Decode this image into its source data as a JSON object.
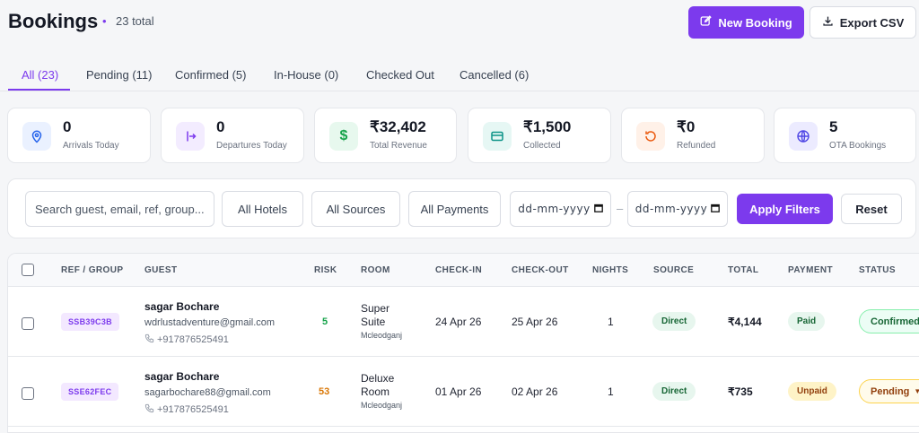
{
  "header": {
    "title": "Bookings",
    "dot": "•",
    "total": "23 total",
    "new_booking": "New Booking",
    "export_csv": "Export CSV"
  },
  "tabs": [
    {
      "label": "All (23)",
      "active": true
    },
    {
      "label": "Pending (11)"
    },
    {
      "label": "Confirmed (5)"
    },
    {
      "label": "In-House (0)"
    },
    {
      "label": "Checked Out"
    },
    {
      "label": "Cancelled (6)"
    }
  ],
  "stats": [
    {
      "value": "0",
      "label": "Arrivals Today",
      "icon": "location-pin-icon",
      "color": "#2563eb"
    },
    {
      "value": "0",
      "label": "Departures Today",
      "icon": "logout-icon",
      "color": "#7c3aed"
    },
    {
      "value": "₹32,402",
      "label": "Total Revenue",
      "icon": "dollar-icon",
      "color": "#16a34a"
    },
    {
      "value": "₹1,500",
      "label": "Collected",
      "icon": "credit-card-icon",
      "color": "#0d9488"
    },
    {
      "value": "₹0",
      "label": "Refunded",
      "icon": "refund-icon",
      "color": "#ea580c"
    },
    {
      "value": "5",
      "label": "OTA Bookings",
      "icon": "globe-icon",
      "color": "#4f46e5"
    }
  ],
  "filters": {
    "search_placeholder": "Search guest, email, ref, group...",
    "hotels": "All Hotels",
    "sources": "All Sources",
    "payments": "All Payments",
    "date_from": "dd-mm-yyyy",
    "date_sep": "–",
    "date_to": "dd-mm-yyyy",
    "apply": "Apply Filters",
    "reset": "Reset"
  },
  "table": {
    "columns": [
      "REF / GROUP",
      "GUEST",
      "RISK",
      "ROOM",
      "CHECK-IN",
      "CHECK-OUT",
      "NIGHTS",
      "SOURCE",
      "TOTAL",
      "PAYMENT",
      "STATUS"
    ],
    "rows": [
      {
        "ref": "SSB39C3B",
        "guest_name": "sagar Bochare",
        "email": "wdrlustadventure@gmail.com",
        "phone": "+917876525491",
        "risk": "5",
        "risk_color": "#16a34a",
        "room": "Super Suite",
        "location": "Mcleodganj",
        "check_in": "24 Apr 26",
        "check_out": "25 Apr 26",
        "nights": "1",
        "source": "Direct",
        "total": "₹4,144",
        "payment": "Paid",
        "status": "Confirmed"
      },
      {
        "ref": "SSE62FEC",
        "guest_name": "sagar Bochare",
        "email": "sagarbochare88@gmail.com",
        "phone": "+917876525491",
        "risk": "53",
        "risk_color": "#d97706",
        "room": "Deluxe Room",
        "location": "Mcleodganj",
        "check_in": "01 Apr 26",
        "check_out": "02 Apr 26",
        "nights": "1",
        "source": "Direct",
        "total": "₹735",
        "payment": "Unpaid",
        "status": "Pending"
      }
    ]
  }
}
